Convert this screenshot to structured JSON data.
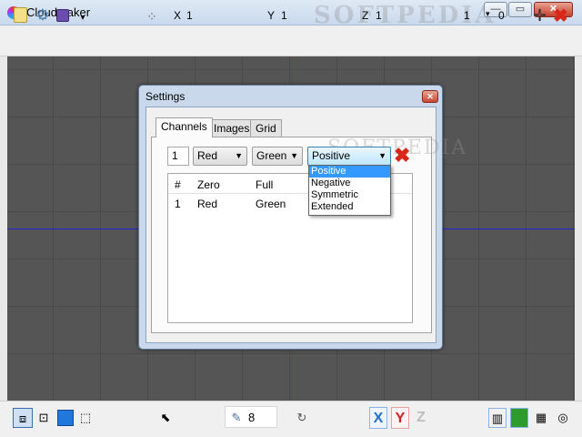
{
  "window": {
    "title": "Cloudmaker",
    "min_glyph": "—",
    "max_glyph": "▭",
    "close_glyph": "✕"
  },
  "toolbar": {
    "coords": {
      "x_label": "X",
      "x_value": "1",
      "y_label": "Y",
      "y_value": "1",
      "z_label": "Z",
      "z_value": "1"
    },
    "step_value": "1",
    "step_zero": "0"
  },
  "icons": {
    "disk_dropdown": "▾",
    "axes": "⁘",
    "step_arrow": "▾",
    "crosshair": "✛",
    "toolbar_close": "✖",
    "view_persp": "⧈",
    "view_front": "⊡",
    "view_wire": "⬚",
    "pick": "⬉",
    "brush": "✎",
    "rotate": "↻",
    "chart": "▥",
    "grid": "▦",
    "target": "◎",
    "delete": "✖"
  },
  "bottombar": {
    "brush_size": "8",
    "axis_x": "X",
    "axis_y": "Y",
    "axis_z": "Z"
  },
  "dialog": {
    "title": "Settings",
    "close_glyph": "✕",
    "tabs": [
      "Channels",
      "Images",
      "Grid"
    ],
    "channel_number": "1",
    "zero_combo": "Red",
    "full_combo": "Green",
    "mode_combo": "Positive",
    "combo_arrow": "▼",
    "columns": [
      "#",
      "Zero",
      "Full"
    ],
    "rows": [
      {
        "num": "1",
        "zero": "Red",
        "full": "Green"
      }
    ],
    "mode_options": [
      "Positive",
      "Negative",
      "Symmetric",
      "Extended"
    ]
  },
  "watermark": "SOFTPEDIA",
  "colors": {
    "axis_x": "#2222d8",
    "axis_y": "#d21b1b",
    "accent": "#3399ff"
  }
}
